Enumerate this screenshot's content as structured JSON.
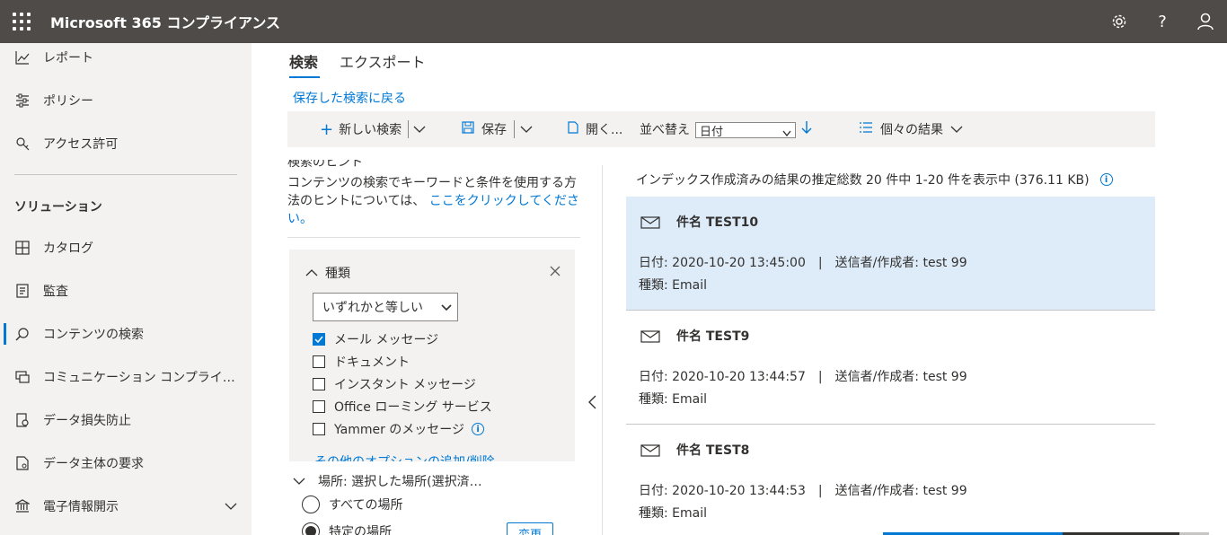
{
  "app": {
    "title": "Microsoft 365 コンプライアンス"
  },
  "header": {
    "settings_icon": "gear-icon",
    "help_label": "?",
    "account_icon": "person-icon"
  },
  "nav": {
    "items_top": [
      {
        "label": "レポート",
        "icon": "chart-icon"
      },
      {
        "label": "ポリシー",
        "icon": "sliders-icon"
      },
      {
        "label": "アクセス許可",
        "icon": "key-icon"
      }
    ],
    "section_heading": "ソリューション",
    "items": [
      {
        "label": "カタログ",
        "icon": "catalog-icon"
      },
      {
        "label": "監査",
        "icon": "audit-icon"
      },
      {
        "label": "コンテンツの検索",
        "icon": "search-icon",
        "active": true
      },
      {
        "label": "コミュニケーション コンプライ…",
        "icon": "chat-icon"
      },
      {
        "label": "データ損失防止",
        "icon": "dlp-icon"
      },
      {
        "label": "データ主体の要求",
        "icon": "document-icon"
      },
      {
        "label": "電子情報開示",
        "icon": "bank-icon"
      }
    ]
  },
  "tabs": [
    {
      "label": "検索"
    },
    {
      "label": "エクスポート"
    }
  ],
  "back_link": "保存した検索に戻る",
  "toolbar": {
    "new_search": "新しい検索",
    "save": "保存",
    "open": "開く...",
    "sort_by": "並べ替え",
    "sort_value": "日付",
    "view": "個々の結果"
  },
  "filter": {
    "hint_cut": "検索のヒント",
    "hint_text": "コンテンツの検索でキーワードと条件を使用する方法のヒントについては、",
    "hint_link": "ここをクリックしてください。",
    "card_title": "種類",
    "operator": "いずれかと等しい",
    "options": [
      {
        "label": "メール メッセージ",
        "checked": true
      },
      {
        "label": "ドキュメント",
        "checked": false
      },
      {
        "label": "インスタント メッセージ",
        "checked": false
      },
      {
        "label": "Office ローミング サービス",
        "checked": false
      },
      {
        "label": "Yammer のメッセージ",
        "checked": false
      }
    ],
    "more_options": "その他のオプションの追加/削除",
    "location_label": "場所: 選択した場所(選択済…",
    "all_locations": "すべての場所",
    "specific_locations": "特定の場所",
    "change_button": "変更"
  },
  "results": {
    "summary": "インデックス作成済みの結果の推定総数 20 件中 1-20 件を表示中 (376.11 KB)",
    "items": [
      {
        "subject": "件名 TEST10",
        "date": "日付: 2020-10-20 13:45:00",
        "sender": "送信者/作成者: test 99",
        "type": "種類: Email",
        "selected": true
      },
      {
        "subject": "件名 TEST9",
        "date": "日付: 2020-10-20 13:44:57",
        "sender": "送信者/作成者: test 99",
        "type": "種類: Email",
        "selected": false
      },
      {
        "subject": "件名 TEST8",
        "date": "日付: 2020-10-20 13:44:53",
        "sender": "送信者/作成者: test 99",
        "type": "種類: Email",
        "selected": false
      }
    ]
  }
}
